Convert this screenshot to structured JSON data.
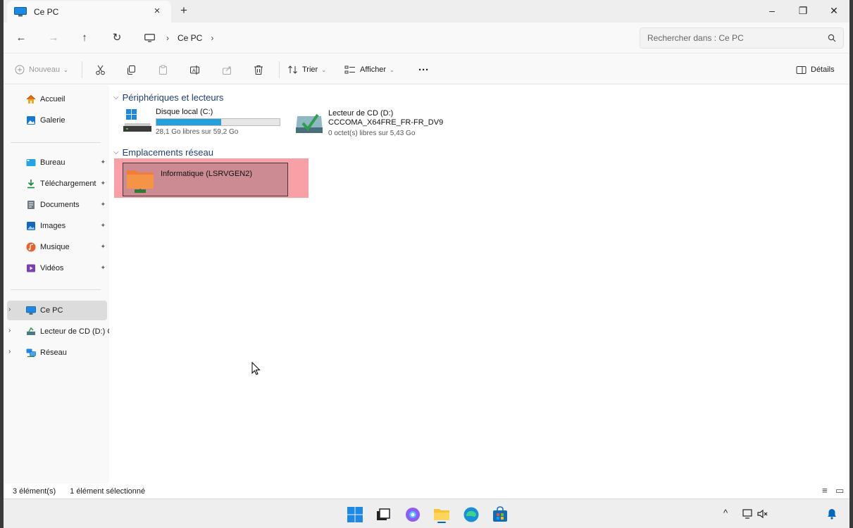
{
  "window": {
    "tab_title": "Ce PC",
    "tab_close": "×",
    "tab_add": "+",
    "minimize": "–",
    "maximize": "❐",
    "close": "✕"
  },
  "address": {
    "back": "←",
    "forward": "→",
    "up": "↑",
    "refresh": "↻",
    "sep1": "›",
    "crumb": "Ce PC",
    "sep2": "›",
    "search_placeholder": "Rechercher dans : Ce PC"
  },
  "toolbar": {
    "new_label": "Nouveau",
    "sort_label": "Trier",
    "view_label": "Afficher",
    "more": "···",
    "details_label": "Détails"
  },
  "sidebar": {
    "home": "Accueil",
    "gallery": "Galerie",
    "desktop": "Bureau",
    "downloads": "Téléchargement",
    "documents": "Documents",
    "pictures": "Images",
    "music": "Musique",
    "videos": "Vidéos",
    "this_pc": "Ce PC",
    "cd_drive": "Lecteur de CD (D:) C",
    "network": "Réseau",
    "pin": "📌",
    "expand": "›"
  },
  "content": {
    "group_devices": "Périphériques et lecteurs",
    "group_network": "Emplacements réseau",
    "drive_c": {
      "name": "Disque local (C:)",
      "free": "28,1 Go libres sur 59,2 Go",
      "used_fraction": 0.525
    },
    "drive_d": {
      "name": "Lecteur de CD (D:)",
      "label": "CCCOMA_X64FRE_FR-FR_DV9",
      "free": "0 octet(s) libres sur 5,43 Go"
    },
    "network_item": "Informatique (LSRVGEN2)"
  },
  "status": {
    "count": "3 élément(s)",
    "selected": "1 élément sélectionné"
  },
  "colors": {
    "accent": "#0067c0",
    "drive_bar": "#26a0da",
    "selection": "#f8a0a5"
  }
}
